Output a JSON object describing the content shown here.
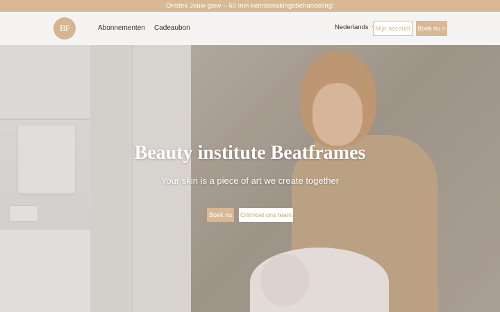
{
  "announcement": "Ontdek Jouw glow – 60 min kennismakingsbehandeling!",
  "header": {
    "logo_text": "BF",
    "nav": [
      {
        "label": "Abonnementen"
      },
      {
        "label": "Cadeaubon"
      }
    ],
    "language": "Nederlands",
    "account_label": "Mijn account",
    "book_label": "Boek nu >"
  },
  "hero": {
    "title": "Beauty institute Beatframes",
    "subtitle": "Your skin is a piece of art we create together",
    "primary_button": "Boek nu",
    "secondary_button": "Ontmoet ons team"
  },
  "colors": {
    "accent": "#d9b894",
    "background": "#f5f4f3",
    "text": "#2e2e2e"
  },
  "icons": {
    "language_dropdown": "chevron-down-icon"
  }
}
